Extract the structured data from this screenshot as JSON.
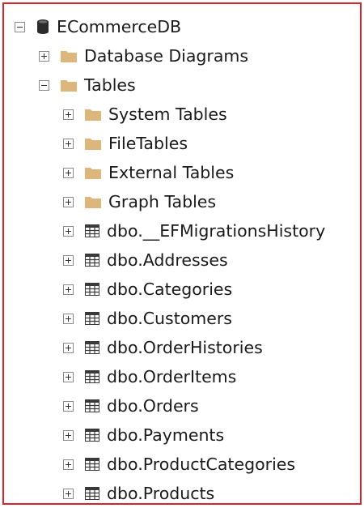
{
  "tree": {
    "root": {
      "label": "ECommerceDB",
      "icon": "database-icon",
      "expanded": true
    },
    "database_diagrams": {
      "label": "Database Diagrams",
      "icon": "folder-icon",
      "expanded": false
    },
    "tables": {
      "label": "Tables",
      "icon": "folder-icon",
      "expanded": true
    },
    "folders": [
      {
        "label": "System Tables",
        "icon": "folder-icon"
      },
      {
        "label": "FileTables",
        "icon": "folder-icon"
      },
      {
        "label": "External Tables",
        "icon": "folder-icon"
      },
      {
        "label": "Graph Tables",
        "icon": "folder-icon"
      }
    ],
    "table_items": [
      {
        "label": "dbo.__EFMigrationsHistory",
        "icon": "table-icon"
      },
      {
        "label": "dbo.Addresses",
        "icon": "table-icon"
      },
      {
        "label": "dbo.Categories",
        "icon": "table-icon"
      },
      {
        "label": "dbo.Customers",
        "icon": "table-icon"
      },
      {
        "label": "dbo.OrderHistories",
        "icon": "table-icon"
      },
      {
        "label": "dbo.OrderItems",
        "icon": "table-icon"
      },
      {
        "label": "dbo.Orders",
        "icon": "table-icon"
      },
      {
        "label": "dbo.Payments",
        "icon": "table-icon"
      },
      {
        "label": "dbo.ProductCategories",
        "icon": "table-icon"
      },
      {
        "label": "dbo.Products",
        "icon": "table-icon"
      }
    ]
  },
  "colors": {
    "frame_border": "#d8232a",
    "folder": "#dcb67a",
    "database": "#2b2b2b",
    "table_icon": "#3a3a3a"
  }
}
